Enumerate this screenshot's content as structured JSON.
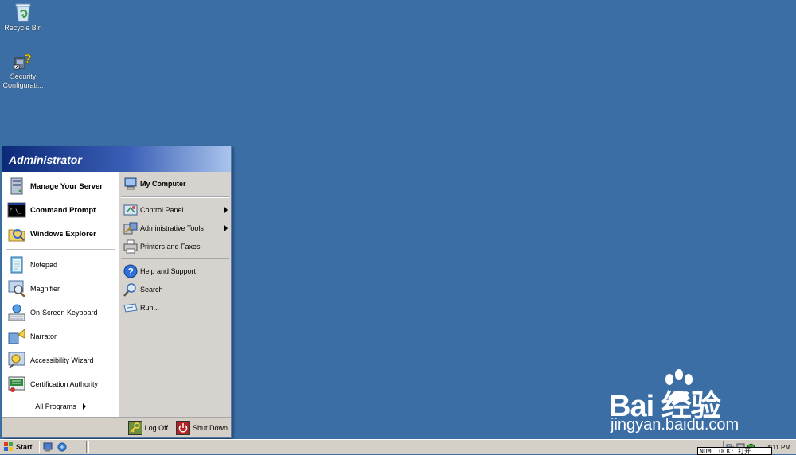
{
  "desktop": {
    "icons": [
      {
        "label": "Recycle Bin",
        "icon": "recycle-bin-icon"
      },
      {
        "label": "Security Configurati...",
        "label_line1": "Security",
        "label_line2": "Configurati...",
        "icon": "security-configuration-icon"
      }
    ]
  },
  "start_menu": {
    "user": "Administrator",
    "pinned": [
      {
        "label": "Manage Your Server",
        "icon": "server-icon"
      },
      {
        "label": "Command Prompt",
        "icon": "command-prompt-icon"
      },
      {
        "label": "Windows Explorer",
        "icon": "explorer-icon"
      }
    ],
    "recent": [
      {
        "label": "Notepad",
        "icon": "notepad-icon"
      },
      {
        "label": "Magnifier",
        "icon": "magnifier-icon"
      },
      {
        "label": "On-Screen Keyboard",
        "icon": "keyboard-icon"
      },
      {
        "label": "Narrator",
        "icon": "narrator-icon"
      },
      {
        "label": "Accessibility Wizard",
        "icon": "accessibility-icon"
      },
      {
        "label": "Certification Authority",
        "icon": "certificate-icon"
      }
    ],
    "all_programs": "All Programs",
    "right": {
      "my_computer": "My Computer",
      "control_panel": "Control Panel",
      "admin_tools": "Administrative Tools",
      "printers": "Printers and Faxes",
      "help": "Help and Support",
      "search": "Search",
      "run": "Run..."
    },
    "footer": {
      "log_off": "Log Off",
      "shut_down": "Shut Down"
    }
  },
  "taskbar": {
    "start_label": "Start",
    "clock": "4:11 PM"
  },
  "status_overlay": "NUM LOCK: 打开",
  "watermark": {
    "brand": "Bai 经验",
    "url": "jingyan.baidu.com"
  },
  "colors": {
    "desktop": "#3a6ea5",
    "menu_header_start": "#0c2a78",
    "menu_header_end": "#a9c4ec"
  }
}
